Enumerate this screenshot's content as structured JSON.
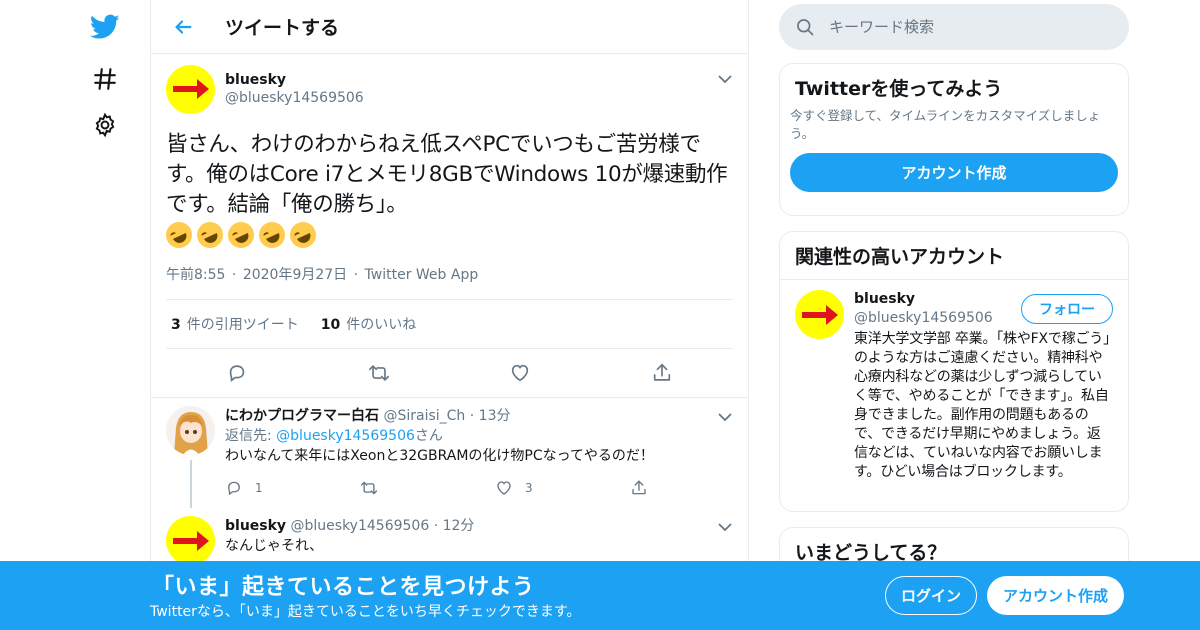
{
  "header": {
    "title": "ツイートする"
  },
  "tweet": {
    "author_name": "bluesky",
    "author_handle": "@bluesky14569506",
    "text": "皆さん、わけのわからねえ低スペPCでいつもご苦労様です。俺のはCore i7とメモリ8GBでWindows 10が爆速動作です。結論「俺の勝ち」。",
    "emoji_count": 5,
    "time": "午前8:55",
    "date": "2020年9月27日",
    "source": "Twitter Web App",
    "sep": "·",
    "retweet_count": "3",
    "retweet_label": "件の引用ツイート",
    "like_count": "10",
    "like_label": "件のいいね"
  },
  "replies": [
    {
      "name": "にわかプログラマー白石",
      "handle": "@Siraisi_Ch",
      "time": "13分",
      "reply_to_label": "返信先: ",
      "reply_to_handle": "@bluesky14569506",
      "reply_to_suffix": "さん",
      "text": "わいなんて来年にはXeonと32GBRAMの化け物PCなってやるのだ！",
      "reply_count": "1",
      "like_count": "3"
    },
    {
      "name": "bluesky",
      "handle": "@bluesky14569506",
      "time": "12分",
      "text": "なんじゃそれ、"
    }
  ],
  "search": {
    "placeholder": "キーワード検索"
  },
  "signup_card": {
    "title": "Twitterを使ってみよう",
    "subtitle": "今すぐ登録して、タイムラインをカスタマイズしましょう。",
    "button": "アカウント作成"
  },
  "related": {
    "title": "関連性の高いアカウント",
    "name": "bluesky",
    "handle": "@bluesky14569506",
    "follow_label": "フォロー",
    "bio": "東洋大学文学部 卒業。「株やFXで稼ごう」のような方はご遠慮ください。精神科や心療内科などの薬は少しずつ減らしていく等で、やめることが「できます」。私自身できました。副作用の問題もあるので、できるだけ早期にやめましょう。返信などは、ていねいな内容でお願いします。ひどい場合はブロックします。"
  },
  "trends": {
    "title": "いまどうしてる？"
  },
  "banner": {
    "title": "「いま」起きていることを見つけよう",
    "subtitle": "Twitterなら、「いま」起きていることをいち早くチェックできます。",
    "login": "ログイン",
    "signup": "アカウント作成"
  },
  "colors": {
    "accent": "#1da1f2",
    "border": "#e6ecf0",
    "muted": "#657786",
    "avatar_bg": "#ffff00",
    "arrow": "#e0141e"
  }
}
